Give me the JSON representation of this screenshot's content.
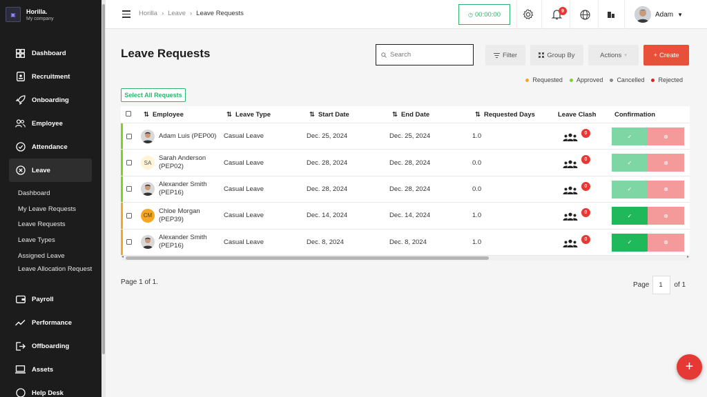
{
  "brand": {
    "name": "Horilla.",
    "subtitle": "My company"
  },
  "sidebar": {
    "items": [
      {
        "label": "Dashboard",
        "icon": "grid-icon"
      },
      {
        "label": "Recruitment",
        "icon": "tablet-icon"
      },
      {
        "label": "Onboarding",
        "icon": "rocket-icon"
      },
      {
        "label": "Employee",
        "icon": "users-icon"
      },
      {
        "label": "Attendance",
        "icon": "check-circle-icon"
      },
      {
        "label": "Leave",
        "icon": "x-circle-icon"
      }
    ],
    "leave_sub": [
      "Dashboard",
      "My Leave Requests",
      "Leave Requests",
      "Leave Types",
      "Assigned Leave",
      "Leave Allocation Request"
    ],
    "items_after": [
      {
        "label": "Payroll",
        "icon": "wallet-icon"
      },
      {
        "label": "Performance",
        "icon": "trend-icon"
      },
      {
        "label": "Offboarding",
        "icon": "exit-icon"
      },
      {
        "label": "Assets",
        "icon": "laptop-icon"
      },
      {
        "label": "Help Desk",
        "icon": "help-icon"
      }
    ]
  },
  "topbar": {
    "breadcrumb": [
      "Horilla",
      "Leave",
      "Leave Requests"
    ],
    "timer": "00:00:00",
    "notification_count": "9",
    "user_name": "Adam"
  },
  "page": {
    "title": "Leave Requests",
    "search_placeholder": "Search",
    "filter_label": "Filter",
    "group_by_label": "Group By",
    "actions_label": "Actions",
    "create_label": "Create",
    "select_all_label": "Select All Requests"
  },
  "legend": [
    {
      "label": "Requested",
      "color": "#f5a623"
    },
    {
      "label": "Approved",
      "color": "#7ed321"
    },
    {
      "label": "Cancelled",
      "color": "#888888"
    },
    {
      "label": "Rejected",
      "color": "#e0201b"
    }
  ],
  "table": {
    "columns": [
      "Employee",
      "Leave Type",
      "Start Date",
      "End Date",
      "Requested Days",
      "Leave Clash",
      "Confirmation"
    ],
    "rows": [
      {
        "employee": "Adam Luis (PEP00)",
        "avatar": "photo",
        "leave_type": "Casual Leave",
        "start": "Dec. 25, 2024",
        "end": "Dec. 25, 2024",
        "days": "1.0",
        "clash": "0",
        "status_color": "#7ed321",
        "approved": false
      },
      {
        "employee": "Sarah Anderson (PEP02)",
        "avatar": "SA",
        "leave_type": "Casual Leave",
        "start": "Dec. 28, 2024",
        "end": "Dec. 28, 2024",
        "days": "0.0",
        "clash": "0",
        "status_color": "#7ed321",
        "approved": false
      },
      {
        "employee": "Alexander Smith (PEP16)",
        "avatar": "photo",
        "leave_type": "Casual Leave",
        "start": "Dec. 28, 2024",
        "end": "Dec. 28, 2024",
        "days": "0.0",
        "clash": "0",
        "status_color": "#7ed321",
        "approved": false
      },
      {
        "employee": "Chloe Morgan (PEP39)",
        "avatar": "CM",
        "leave_type": "Casual Leave",
        "start": "Dec. 14, 2024",
        "end": "Dec. 14, 2024",
        "days": "1.0",
        "clash": "0",
        "status_color": "#f5a623",
        "approved": true
      },
      {
        "employee": "Alexander Smith (PEP16)",
        "avatar": "photo",
        "leave_type": "Casual Leave",
        "start": "Dec. 8, 2024",
        "end": "Dec. 8, 2024",
        "days": "1.0",
        "clash": "0",
        "status_color": "#f5a623",
        "approved": true
      }
    ]
  },
  "pagination": {
    "summary": "Page 1 of 1.",
    "page_label": "Page",
    "current": "1",
    "of_label": "of 1"
  }
}
